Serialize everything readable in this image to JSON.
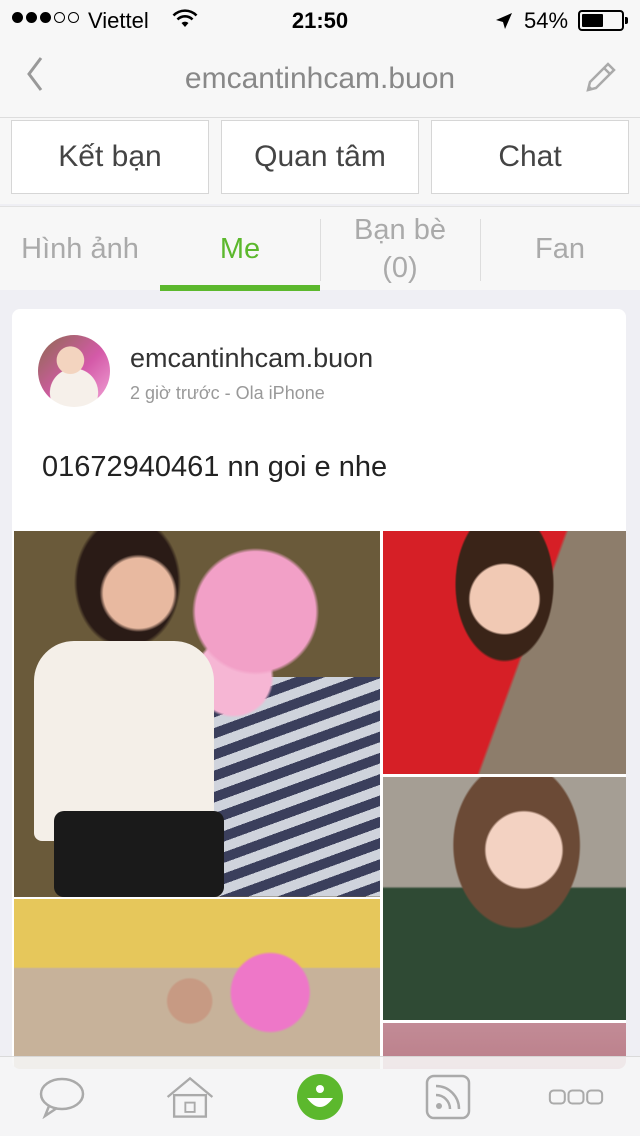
{
  "status_bar": {
    "carrier": "Viettel",
    "time": "21:50",
    "battery_percent": "54%",
    "battery_level": 0.54,
    "signal_bars_filled": 3,
    "signal_bars_total": 5
  },
  "nav": {
    "title": "emcantinhcam.buon",
    "back_icon": "chevron-left-icon",
    "edit_icon": "pencil-icon"
  },
  "actions": {
    "add_friend": "Kết bạn",
    "follow": "Quan tâm",
    "chat": "Chat"
  },
  "tabs": {
    "photos": "Hình ảnh",
    "me": "Me",
    "friends_line1": "Bạn bè",
    "friends_line2": "(0)",
    "fan": "Fan",
    "active": "me",
    "accent_color": "#5cb82d"
  },
  "post": {
    "username": "emcantinhcam.buon",
    "meta": "2 giờ trước - Ola iPhone",
    "text": "01672940461 nn goi e nhe"
  },
  "tab_bar": {
    "items": [
      "chat-bubble-icon",
      "home-icon",
      "ola-face-icon",
      "rss-feed-icon",
      "more-icon"
    ],
    "active": "ola-face-icon"
  }
}
